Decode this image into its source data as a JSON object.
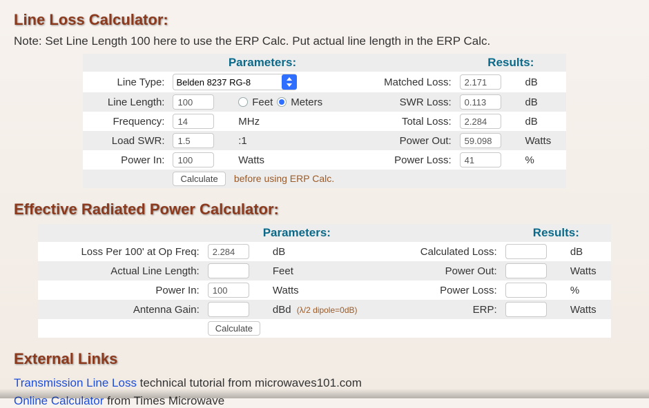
{
  "line_loss": {
    "title": "Line Loss Calculator:",
    "note": "Note: Set Line Length 100 here to use the ERP Calc. Put actual line length in the ERP Calc.",
    "params_header": "Parameters:",
    "results_header": "Results:",
    "labels": {
      "line_type": "Line Type:",
      "line_length": "Line Length:",
      "frequency": "Frequency:",
      "load_swr": "Load SWR:",
      "power_in": "Power In:"
    },
    "values": {
      "line_type": "Belden 8237 RG-8",
      "line_length": "100",
      "frequency": "14",
      "load_swr": "1.5",
      "power_in": "100"
    },
    "units": {
      "feet": "Feet",
      "meters": "Meters",
      "mhz": "MHz",
      "colon1": ":1",
      "watts": "Watts",
      "db": "dB",
      "percent": "%"
    },
    "results_labels": {
      "matched_loss": "Matched Loss:",
      "swr_loss": "SWR Loss:",
      "total_loss": "Total Loss:",
      "power_out": "Power Out:",
      "power_loss": "Power Loss:"
    },
    "results_values": {
      "matched_loss": "2.171",
      "swr_loss": "0.113",
      "total_loss": "2.284",
      "power_out": "59.098",
      "power_loss": "41"
    },
    "calculate": "Calculate",
    "calc_note": "before using ERP Calc."
  },
  "erp": {
    "title": "Effective Radiated Power Calculator:",
    "params_header": "Parameters:",
    "results_header": "Results:",
    "labels": {
      "loss_per100": "Loss Per 100' at Op Freq:",
      "actual_length": "Actual Line Length:",
      "power_in": "Power In:",
      "antenna_gain": "Antenna Gain:"
    },
    "values": {
      "loss_per100": "2.284",
      "actual_length": "",
      "power_in": "100",
      "antenna_gain": ""
    },
    "units": {
      "db": "dB",
      "feet": "Feet",
      "watts": "Watts",
      "dbd": "dBd",
      "percent": "%"
    },
    "dipole_note": "(λ/2 dipole=0dB)",
    "results_labels": {
      "calculated_loss": "Calculated Loss:",
      "power_out": "Power Out:",
      "power_loss": "Power Loss:",
      "erp": "ERP:"
    },
    "results_values": {
      "calculated_loss": "",
      "power_out": "",
      "power_loss": "",
      "erp": ""
    },
    "calculate": "Calculate"
  },
  "external": {
    "title": "External Links",
    "link1_text": "Transmission Line Loss",
    "link1_rest": " technical tutorial from microwaves101.com",
    "link2_text": "Online Calculator",
    "link2_rest": " from Times Microwave"
  }
}
